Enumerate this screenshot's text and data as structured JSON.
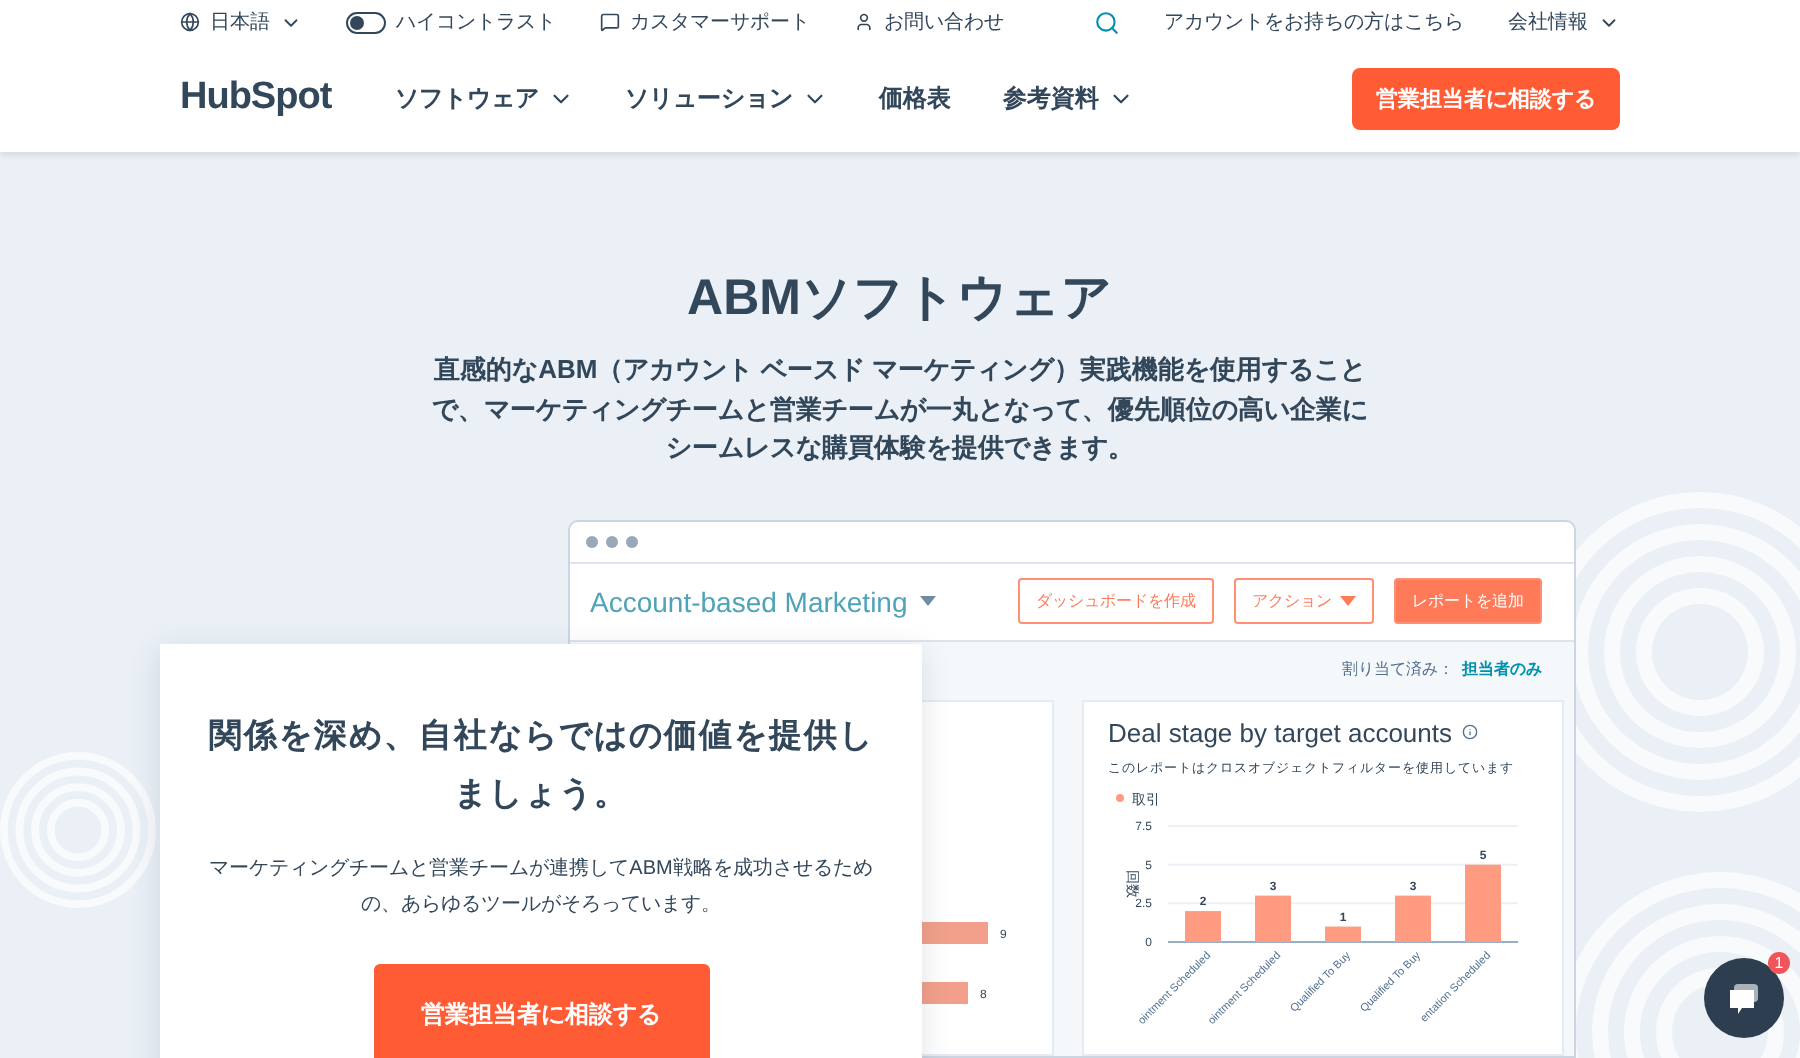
{
  "utility_bar": {
    "language": "日本語",
    "high_contrast": {
      "label": "ハイコントラスト",
      "on": false
    },
    "support": "カスタマーサポート",
    "contact": "お問い合わせ",
    "login": "アカウントをお持ちの方はこちら",
    "company": "会社情報"
  },
  "nav": {
    "logo": "HubSpot",
    "items": [
      {
        "label": "ソフトウェア",
        "has_menu": true
      },
      {
        "label": "ソリューション",
        "has_menu": true
      },
      {
        "label": "価格表",
        "has_menu": false
      },
      {
        "label": "参考資料",
        "has_menu": true
      }
    ],
    "cta": "営業担当者に相談する"
  },
  "hero": {
    "title": "ABMソフトウェア",
    "subtitle": "直感的なABM（アカウント ベースド マーケティング）実践機能を使用することで、マーケティングチームと営業チームが一丸となって、優先順位の高い企業にシームレスな購買体験を提供できます。"
  },
  "dashboard": {
    "title": "Account-based Marketing",
    "buttons": [
      {
        "label": "ダッシュボードを作成",
        "kind": "outline"
      },
      {
        "label": "アクション",
        "kind": "menu"
      },
      {
        "label": "レポートを追加",
        "kind": "primary"
      }
    ],
    "filter_label": "割り当て済み：",
    "filter_value": "担当者のみ",
    "left_chart": {
      "bar_labels": [
        "9",
        "8"
      ]
    },
    "report": {
      "title": "Deal stage by target accounts",
      "note": "このレポートはクロスオブジェクトフィルターを使用しています",
      "chart_data": {
        "type": "bar",
        "ylabel": "回数",
        "categories": [
          "ointment Scheduled",
          "ointment Scheduled",
          "Qualified To Buy",
          "Qualified To Buy",
          "entation Scheduled"
        ],
        "series": [
          {
            "name": "取引",
            "color": "#ff9b80",
            "values": [
              2,
              3,
              1,
              3,
              5
            ]
          }
        ],
        "yticks": [
          {
            "value": 0,
            "label": "0"
          },
          {
            "value": 2.5,
            "label": "2.5"
          },
          {
            "value": 5,
            "label": "5"
          },
          {
            "value": 7.5,
            "label": "7.5"
          }
        ],
        "ylim": [
          0,
          7.5
        ],
        "data_labels": true
      }
    }
  },
  "card": {
    "title": "関係を深め、自社ならではの価値を提供しましょう。",
    "text": "マーケティングチームと営業チームが連携してABM戦略を成功させるための、あらゆるツールがそろっています。",
    "button": "営業担当者に相談する"
  },
  "chat": {
    "badge": "1"
  }
}
